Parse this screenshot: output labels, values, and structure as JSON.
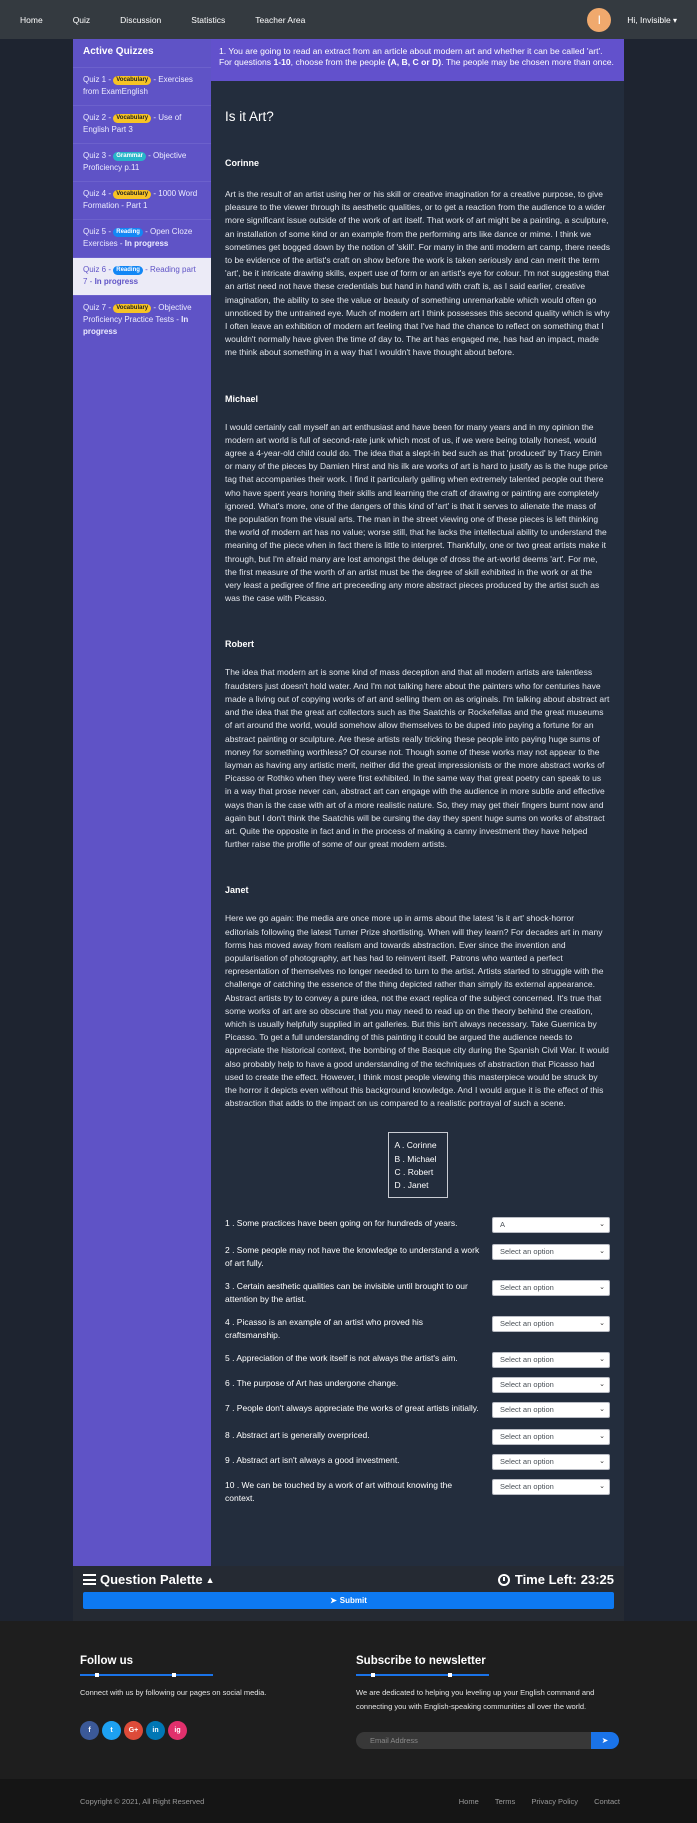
{
  "nav": {
    "links": [
      "Home",
      "Quiz",
      "Discussion",
      "Statistics",
      "Teacher Area"
    ],
    "avatar_initial": "I",
    "user": "Hi, Invisible"
  },
  "sidebar": {
    "title": "Active Quizzes",
    "items": [
      {
        "prefix": "Quiz 1 - ",
        "badge": "Vocabulary",
        "badge_kind": "vocab",
        "text": " - Exercises from ExamEnglish",
        "status": ""
      },
      {
        "prefix": "Quiz 2 - ",
        "badge": "Vocabulary",
        "badge_kind": "vocab",
        "text": " - Use of English Part 3",
        "status": ""
      },
      {
        "prefix": "Quiz 3 - ",
        "badge": "Grammar",
        "badge_kind": "grammar",
        "text": " - Objective Proficiency p.11",
        "status": ""
      },
      {
        "prefix": "Quiz 4 - ",
        "badge": "Vocabulary",
        "badge_kind": "vocab",
        "text": " - 1000 Word Formation - Part 1",
        "status": ""
      },
      {
        "prefix": "Quiz 5 - ",
        "badge": "Reading",
        "badge_kind": "reading",
        "text": " - Open Cloze Exercises - ",
        "status": "In progress"
      },
      {
        "prefix": "Quiz 6 - ",
        "badge": "Reading",
        "badge_kind": "reading",
        "text": " - Reading part 7 - ",
        "status": "In progress",
        "active": true
      },
      {
        "prefix": "Quiz 7 - ",
        "badge": "Vocabulary",
        "badge_kind": "vocab",
        "text": " - Objective Proficiency Practice Tests - ",
        "status": "In progress"
      }
    ]
  },
  "instructions": {
    "line1": "1. You are going to read an extract from an article about modern art and whether it can be called 'art'. For questions ",
    "range": "1-10",
    "line2": ", choose from the people ",
    "options": "(A, B, C or D)",
    "line3": ". The people may be chosen more than once."
  },
  "article": {
    "title": "Is it Art?",
    "sections": [
      {
        "name": "Corinne",
        "text": "Art is the result of an artist using her or his skill or creative imagination for a creative purpose, to give pleasure to the viewer through its aesthetic qualities, or to get a reaction from the audience to a wider more significant issue outside of the work of art itself. That work of art might be a painting, a sculpture, an installation of some kind or an example from the performing arts like dance or mime. I think we sometimes get bogged down by the notion of 'skill'. For many in the anti modern art camp, there needs to be evidence of the artist's craft on show before the work is taken seriously and can merit the term 'art', be it intricate drawing skills, expert use of form or an artist's eye for colour. I'm not suggesting that an artist need not have these credentials but hand in hand with craft is, as I said earlier, creative imagination, the ability to see the value or beauty of something unremarkable which would often go unnoticed by the untrained eye. Much of modern art I think possesses this second quality which is why I often leave an exhibition of modern art feeling that I've had the chance to reflect on something that I wouldn't normally have given the time of day to. The art has engaged me, has had an impact, made me think about something in a way that I wouldn't have thought about before."
      },
      {
        "name": "Michael",
        "text": "I would certainly call myself an art enthusiast and have been for many years and in my opinion the modern art world is full of second-rate junk which most of us, if we were being totally honest, would agree a 4-year-old child could do. The idea that a slept-in bed such as that 'produced' by Tracy Emin or many of the pieces by Damien Hirst and his ilk are works of art is hard to justify as is the huge price tag that accompanies their work. I find it particularly galling when extremely talented people out there who have spent years honing their skills and learning the craft of drawing or painting are completely ignored. What's more, one of the dangers of this kind of 'art' is that it serves to alienate the mass of the population from the visual arts. The man in the street viewing one of these pieces is left thinking the world of modern art has no value; worse still, that he lacks the intellectual ability to understand the meaning of the piece when in fact there is little to interpret. Thankfully, one or two great artists make it through, but I'm afraid many are lost amongst the deluge of dross the art-world deems 'art'. For me, the first measure of the worth of an artist must be the degree of skill exhibited in the work or at the very least a pedigree of fine art preceeding any more abstract pieces produced by the artist such as was the case with Picasso."
      },
      {
        "name": "Robert",
        "text": "The idea that modern art is some kind of mass deception and that all modern artists are talentless fraudsters just doesn't hold water. And I'm not talking here about the painters who for centuries have made a living out of copying works of art and selling them on as originals. I'm talking about abstract art and the idea that the great art collectors such as the Saatchis or Rockefellas and the great museums of art around the world, would somehow allow themselves to be duped into paying a fortune for an abstract painting or sculpture. Are these artists really tricking these people into paying huge sums of money for something worthless? Of course not. Though some of these works may not appear to the layman as having any artistic merit, neither did the great impressionists or the more abstract works of Picasso or Rothko when they were first exhibited. In the same way that great poetry can speak to us in a way that prose never can, abstract art can engage with the audience in more subtle and effective ways than is the case with art of a more realistic nature. So, they may get their fingers burnt now and again but I don't think the Saatchis will be cursing the day they spent huge sums on works of abstract art. Quite the opposite in fact and in the process of making a canny investment they have helped further raise the profile of some of our great modern artists."
      },
      {
        "name": "Janet",
        "text": "Here we go again: the media are once more up in arms about the latest 'is it art' shock-horror editorials following the latest Turner Prize shortlisting. When will they learn? For decades art in many forms has moved away from realism and towards abstraction. Ever since the invention and popularisation of photography, art has had to reinvent itself. Patrons who wanted a perfect representation of themselves no longer needed to turn to the artist. Artists started to struggle with the challenge of catching the essence of the thing depicted rather than simply its external appearance. Abstract artists try to convey a pure idea, not the exact replica of the subject concerned. It's true that some works of art are so obscure that you may need to read up on the theory behind the creation, which is usually helpfully supplied in art galleries. But this isn't always necessary. Take Guernica by Picasso. To get a full understanding of this painting it could be argued the audience needs to appreciate the historical context, the bombing of the Basque city during the Spanish Civil War. It would also probably help to have a good understanding of the techniques of abstraction that Picasso had used to create the effect. However, I think most people viewing this masterpiece would be struck by the horror it depicts even without this background knowledge. And I would argue it is the effect of this abstraction that adds to the impact on us compared to a realistic portrayal of such a scene."
      }
    ]
  },
  "answer_options": [
    "A . Corinne",
    "B . Michael",
    "C . Robert",
    "D . Janet"
  ],
  "questions": [
    {
      "text": "1 . Some practices have been going on for hundreds of years.",
      "value": "A"
    },
    {
      "text": "2 . Some people may not have the knowledge to understand a work of art fully.",
      "value": "Select an option"
    },
    {
      "text": "3 . Certain aesthetic qualities can be invisible until brought to our attention by the artist.",
      "value": "Select an option"
    },
    {
      "text": "4 . Picasso is an example of an artist who proved his craftsmanship.",
      "value": "Select an option"
    },
    {
      "text": "5 . Appreciation of the work itself is not always the artist's aim.",
      "value": "Select an option"
    },
    {
      "text": "6 . The purpose of Art has undergone change.",
      "value": "Select an option"
    },
    {
      "text": "7 . People don't always appreciate the works of great artists initially.",
      "value": "Select an option"
    },
    {
      "text": "8 . Abstract art is generally overpriced.",
      "value": "Select an option"
    },
    {
      "text": "9 . Abstract art isn't always a good investment.",
      "value": "Select an option"
    },
    {
      "text": "10 . We can be touched by a work of art without knowing the context.",
      "value": "Select an option"
    }
  ],
  "palette": {
    "title": "Question Palette",
    "time_label": "Time Left: ",
    "time": "23:25",
    "submit": "Submit"
  },
  "footer": {
    "follow_title": "Follow us",
    "follow_text": "Connect with us by following our pages on social media.",
    "socials": [
      {
        "label": "f",
        "icon": "facebook-icon",
        "color": "#3b5998"
      },
      {
        "label": "t",
        "icon": "twitter-icon",
        "color": "#1da1f2"
      },
      {
        "label": "G+",
        "icon": "google-plus-icon",
        "color": "#dd4b39"
      },
      {
        "label": "in",
        "icon": "linkedin-icon",
        "color": "#0077b5"
      },
      {
        "label": "ig",
        "icon": "instagram-icon",
        "color": "#e1306c"
      }
    ],
    "newsletter_title": "Subscribe to newsletter",
    "newsletter_text": "We are dedicated to helping you leveling up your English command and connecting you with English-speaking communities all over the world.",
    "email_placeholder": "Email Address",
    "copyright": "Copyright © 2021, All Right Reserved",
    "links": [
      "Home",
      "Terms",
      "Privacy Policy",
      "Contact"
    ]
  },
  "colors": {
    "sidebar": "#5f53c6",
    "content": "#232d3d",
    "instruction": "#6251cc",
    "submit": "#0d79f2"
  }
}
